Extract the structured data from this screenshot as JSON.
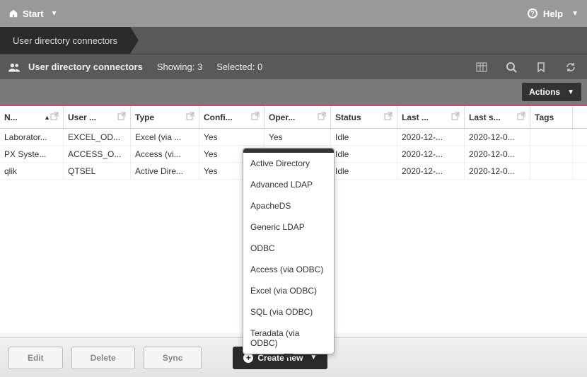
{
  "topbar": {
    "start": "Start",
    "help": "Help"
  },
  "subnav": {
    "tab": "User directory connectors"
  },
  "infobar": {
    "title": "User directory connectors",
    "showing_lbl": "Showing:",
    "showing_val": "3",
    "selected_lbl": "Selected:",
    "selected_val": "0"
  },
  "actions": {
    "label": "Actions"
  },
  "columns": [
    "N...",
    "User ...",
    "Type",
    "Confi...",
    "Oper...",
    "Status",
    "Last ...",
    "Last s...",
    "Tags"
  ],
  "rows": [
    {
      "c": [
        "Laborator...",
        "EXCEL_OD...",
        "Excel (via ...",
        "Yes",
        "Yes",
        "Idle",
        "2020-12-...",
        "2020-12-0...",
        ""
      ]
    },
    {
      "c": [
        "PX Syste...",
        "ACCESS_O...",
        "Access (vi...",
        "Yes",
        "",
        "Idle",
        "2020-12-...",
        "2020-12-0...",
        ""
      ]
    },
    {
      "c": [
        "qlik",
        "QTSEL",
        "Active Dire...",
        "Yes",
        "",
        "Idle",
        "2020-12-...",
        "2020-12-0...",
        ""
      ]
    }
  ],
  "dropdown": [
    "Active Directory",
    "Advanced LDAP",
    "ApacheDS",
    "Generic LDAP",
    "ODBC",
    "Access (via ODBC)",
    "Excel (via ODBC)",
    "SQL (via ODBC)",
    "Teradata (via ODBC)"
  ],
  "footer": {
    "edit": "Edit",
    "delete": "Delete",
    "sync": "Sync",
    "create": "Create new"
  }
}
